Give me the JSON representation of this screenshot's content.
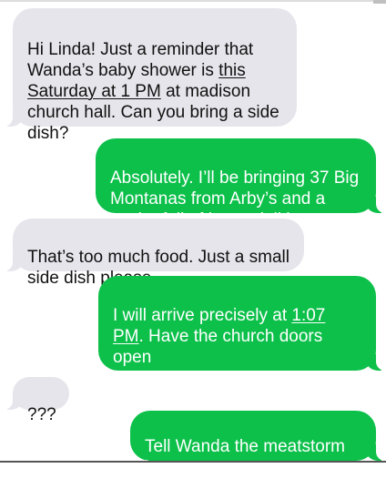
{
  "conversation": {
    "messages": [
      {
        "direction": "incoming",
        "parts": [
          {
            "text": "Hi Linda! Just a reminder that\nWanda’s baby shower is ",
            "underline": false
          },
          {
            "text": "this\nSaturday at 1 PM",
            "underline": true
          },
          {
            "text": " at madison\nchurch hall. Can you bring a side\ndish?",
            "underline": false
          }
        ]
      },
      {
        "direction": "outgoing",
        "parts": [
          {
            "text": "Absolutely. I’ll be bringing 37 Big\nMontanas from Arby’s and a\ncooler full of loose deli ham.",
            "underline": false
          }
        ]
      },
      {
        "direction": "incoming",
        "parts": [
          {
            "text": "That’s too much food. Just a small\nside dish please",
            "underline": false
          }
        ]
      },
      {
        "direction": "outgoing",
        "parts": [
          {
            "text": "I will arrive precisely at ",
            "underline": false
          },
          {
            "text": "1:07\nPM",
            "underline": true
          },
          {
            "text": ". Have the church doors open\nand the priest ready to bless the\nbeef.",
            "underline": false
          }
        ]
      },
      {
        "direction": "incoming",
        "parts": [
          {
            "text": "???",
            "underline": false
          }
        ]
      },
      {
        "direction": "outgoing",
        "parts": [
          {
            "text": "Tell Wanda the meatstorm is\ncoming.",
            "underline": false
          }
        ]
      }
    ]
  },
  "colors": {
    "incoming_bubble": "#e6e5eb",
    "outgoing_bubble": "#0cc04a",
    "incoming_text": "#111111",
    "outgoing_text": "#ffffff"
  }
}
